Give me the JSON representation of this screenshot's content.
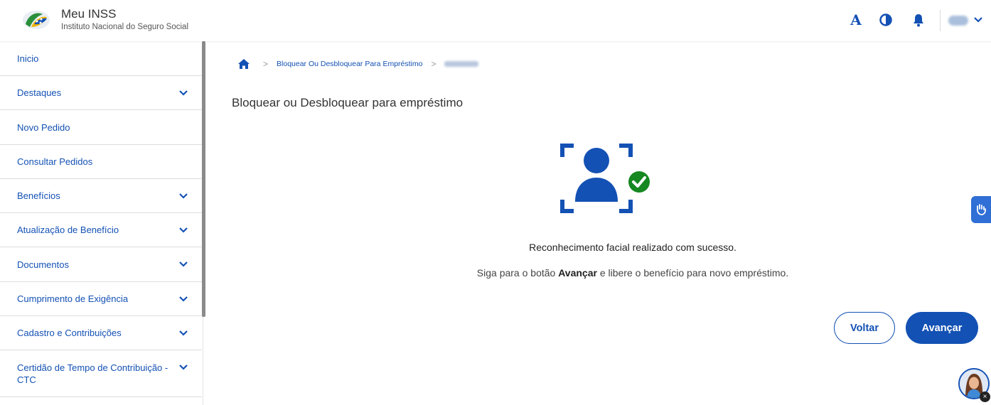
{
  "header": {
    "title": "Meu INSS",
    "subtitle": "Instituto Nacional do Seguro Social",
    "font_size_label": "A"
  },
  "sidebar": {
    "items": [
      {
        "label": "Inicio",
        "expandable": false
      },
      {
        "label": "Destaques",
        "expandable": true
      },
      {
        "label": "Novo Pedido",
        "expandable": false
      },
      {
        "label": "Consultar Pedidos",
        "expandable": false
      },
      {
        "label": "Benefícios",
        "expandable": true
      },
      {
        "label": "Atualização de Benefício",
        "expandable": true
      },
      {
        "label": "Documentos",
        "expandable": true
      },
      {
        "label": "Cumprimento de Exigência",
        "expandable": true
      },
      {
        "label": "Cadastro e Contribuições",
        "expandable": true
      },
      {
        "label": "Certidão de Tempo de Contribuição - CTC",
        "expandable": true
      }
    ]
  },
  "breadcrumb": {
    "link": "Bloquear Ou Desbloquear Para Empréstimo"
  },
  "main": {
    "title": "Bloquear ou Desbloquear para empréstimo",
    "success_message": "Reconhecimento facial realizado com sucesso.",
    "instruction_prefix": "Siga para o botão ",
    "instruction_bold": "Avançar",
    "instruction_suffix": " e libere o benefício para novo empréstimo.",
    "back_label": "Voltar",
    "next_label": "Avançar"
  },
  "colors": {
    "primary": "#1351b4",
    "success": "#168821"
  }
}
